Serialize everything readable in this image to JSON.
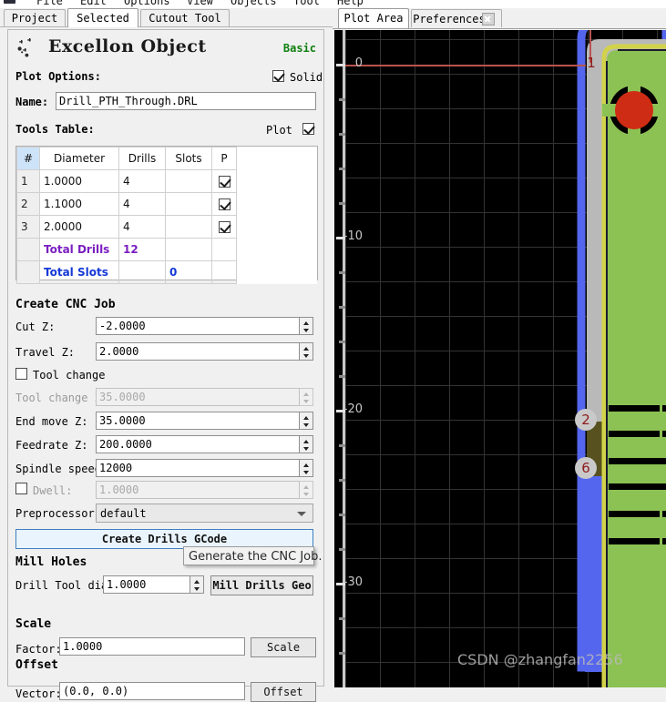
{
  "menubar": {
    "items": [
      "File",
      "Edit",
      "Options",
      "View",
      "Objects",
      "Tool",
      "Help"
    ],
    "logo_icon": "app-logo-icon"
  },
  "left_tabs": [
    {
      "label": "Project",
      "active": false
    },
    {
      "label": "Selected",
      "active": true
    },
    {
      "label": "Cutout Tool",
      "active": false
    }
  ],
  "panel": {
    "icon": "drill-object-icon",
    "title": "Excellon Object",
    "level_label": "Basic",
    "level_color": "#108010",
    "plot_options_label": "Plot Options:",
    "solid_label": "Solid",
    "solid_checked": true,
    "name_label": "Name:",
    "name_value": "Drill_PTH_Through.DRL",
    "tools_table_label": "Tools Table:",
    "plot_label": "Plot",
    "plot_checked": true
  },
  "tools_table": {
    "headers": [
      "#",
      "Diameter",
      "Drills",
      "Slots",
      "P"
    ],
    "rows": [
      {
        "idx": "1",
        "diameter": "1.0000",
        "drills": "4",
        "slots": "",
        "p": true
      },
      {
        "idx": "2",
        "diameter": "1.1000",
        "drills": "4",
        "slots": "",
        "p": true
      },
      {
        "idx": "3",
        "diameter": "2.0000",
        "drills": "4",
        "slots": "",
        "p": true
      }
    ],
    "total_drills_label": "Total Drills",
    "total_drills_value": "12",
    "total_slots_label": "Total Slots",
    "total_slots_value": "0",
    "total_drills_color": "#7a1fc0",
    "total_slots_color": "#1539d6"
  },
  "cnc": {
    "section_title": "Create CNC Job",
    "cut_z_label": "Cut Z:",
    "cut_z_value": "-2.0000",
    "travel_z_label": "Travel Z:",
    "travel_z_value": "2.0000",
    "tool_change_label": "Tool change",
    "tool_change_checked": false,
    "tool_change_z_label": "Tool change Z:",
    "tool_change_z_value": "35.0000",
    "tool_change_z_disabled": true,
    "end_move_z_label": "End move Z:",
    "end_move_z_value": "35.0000",
    "feedrate_z_label": "Feedrate Z:",
    "feedrate_z_value": "200.0000",
    "spindle_label": "Spindle speed:",
    "spindle_value": "12000",
    "dwell_label": "Dwell:",
    "dwell_checked": false,
    "dwell_value": "1.0000",
    "dwell_disabled": true,
    "preprocessor_label": "Preprocessor:",
    "preprocessor_value": "default",
    "create_button": "Create Drills GCode",
    "tooltip": "Generate the CNC Job."
  },
  "mill": {
    "section_title": "Mill Holes",
    "drill_tool_dia_label": "Drill Tool dia:",
    "drill_tool_dia_value": "1.0000",
    "mill_button": "Mill Drills Geo"
  },
  "scale": {
    "section_title": "Scale",
    "factor_label": "Factor:",
    "factor_value": "1.0000",
    "button": "Scale"
  },
  "offset": {
    "section_title": "Offset",
    "vector_label": "Vector:",
    "vector_value": "(0.0, 0.0)",
    "button": "Offset"
  },
  "right_tabs": [
    {
      "label": "Plot Area",
      "active": true,
      "closable": false
    },
    {
      "label": "Preferences",
      "active": false,
      "closable": true
    }
  ],
  "plot": {
    "background": "#000000",
    "grid_color": "#3a3a3a",
    "axis_color": "#c9c9c9",
    "origin_line_color": "#b8544f",
    "y_ticks": [
      "0",
      "-10",
      "-20",
      "-30"
    ],
    "markers": [
      {
        "label": "1",
        "x": 645,
        "y": 66
      },
      {
        "label": "2",
        "x": 640,
        "y": 458
      },
      {
        "label": "6",
        "x": 640,
        "y": 511
      }
    ],
    "board": {
      "outline_color": "#5566ee",
      "milling_color": "#b9b9b9",
      "keepout_color": "#d2d24a",
      "copper_color": "#8cc153",
      "trace_color": "#000000",
      "drill_fill": "#cf2c15"
    },
    "watermark": "CSDN @zhangfan2256"
  }
}
